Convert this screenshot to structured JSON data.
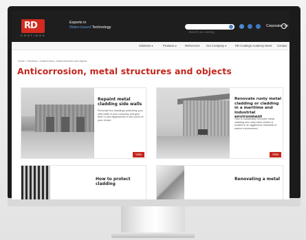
{
  "site": {
    "logo_text": "RD",
    "logo_sub": "COATINGS",
    "tagline_line1": "Experts in",
    "tagline_highlight": "Water-based",
    "tagline_rest": " Technology",
    "search_placeholder": "Search our catalog",
    "corporate_label": "Corporate - en"
  },
  "nav": {
    "items": [
      "Solutions ▾",
      "Products ▾",
      "References",
      "Our Company ▾",
      "RD Coatings Academy",
      "News",
      "Contact"
    ]
  },
  "breadcrumb": "Home > Solutions > Anticorrosion, metal structures and objects",
  "page_title": "Anticorrosion, metal structures and objects",
  "cards": [
    {
      "title": "Repaint metal cladding side walls",
      "desc": "Renovate the claddings protecting your side walls of your company and give them a new appearance in the colors of your choice.",
      "button": "View"
    },
    {
      "title": "Renovate rusty metal cladding or cladding in a maritime and industrial environment",
      "desc": "How to sustainably renovate metal cladding and rusty steel sheets or located in an aggressive industrial or marine environment.",
      "button": "View"
    },
    {
      "title": "How to protect cladding",
      "desc": "",
      "button": ""
    },
    {
      "title": "Renovating a metal",
      "desc": "",
      "button": ""
    }
  ]
}
